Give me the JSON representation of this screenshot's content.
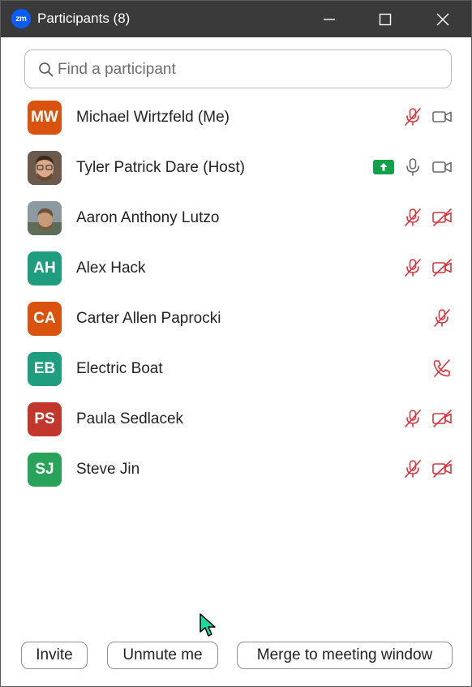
{
  "window": {
    "logo_text": "zm",
    "title": "Participants (8)"
  },
  "search": {
    "placeholder": "Find a participant"
  },
  "participants": [
    {
      "initials": "MW",
      "name": "Michael Wirtzfeld (Me)",
      "avatar_color": "#d9530f",
      "photo": false,
      "sharing": false,
      "mic": "muted",
      "video": "on"
    },
    {
      "initials": "",
      "name": "Tyler Patrick Dare (Host)",
      "avatar_color": "#6b5a4c",
      "photo": true,
      "sharing": true,
      "mic": "on",
      "video": "on"
    },
    {
      "initials": "",
      "name": "Aaron Anthony Lutzo",
      "avatar_color": "#7a8a90",
      "photo": true,
      "sharing": false,
      "mic": "muted",
      "video": "off"
    },
    {
      "initials": "AH",
      "name": "Alex Hack",
      "avatar_color": "#1e9e7e",
      "photo": false,
      "sharing": false,
      "mic": "muted",
      "video": "off"
    },
    {
      "initials": "CA",
      "name": "Carter Allen Paprocki",
      "avatar_color": "#d9530f",
      "photo": false,
      "sharing": false,
      "mic": "muted",
      "video": "none"
    },
    {
      "initials": "EB",
      "name": "Electric Boat",
      "avatar_color": "#1e9e7e",
      "photo": false,
      "sharing": false,
      "mic": "phone-muted",
      "video": "none"
    },
    {
      "initials": "PS",
      "name": "Paula Sedlacek",
      "avatar_color": "#c2372c",
      "photo": false,
      "sharing": false,
      "mic": "muted",
      "video": "off"
    },
    {
      "initials": "SJ",
      "name": "Steve Jin",
      "avatar_color": "#2aa35a",
      "photo": false,
      "sharing": false,
      "mic": "muted",
      "video": "off"
    }
  ],
  "footer": {
    "invite_label": "Invite",
    "unmute_label": "Unmute me",
    "merge_label": "Merge to meeting window"
  },
  "colors": {
    "titlebar": "#3a3a3a",
    "muted_red": "#d9363e",
    "icon_gray": "#6b6b6b",
    "share_green": "#12a04a",
    "zoom_blue": "#0b5cff"
  }
}
